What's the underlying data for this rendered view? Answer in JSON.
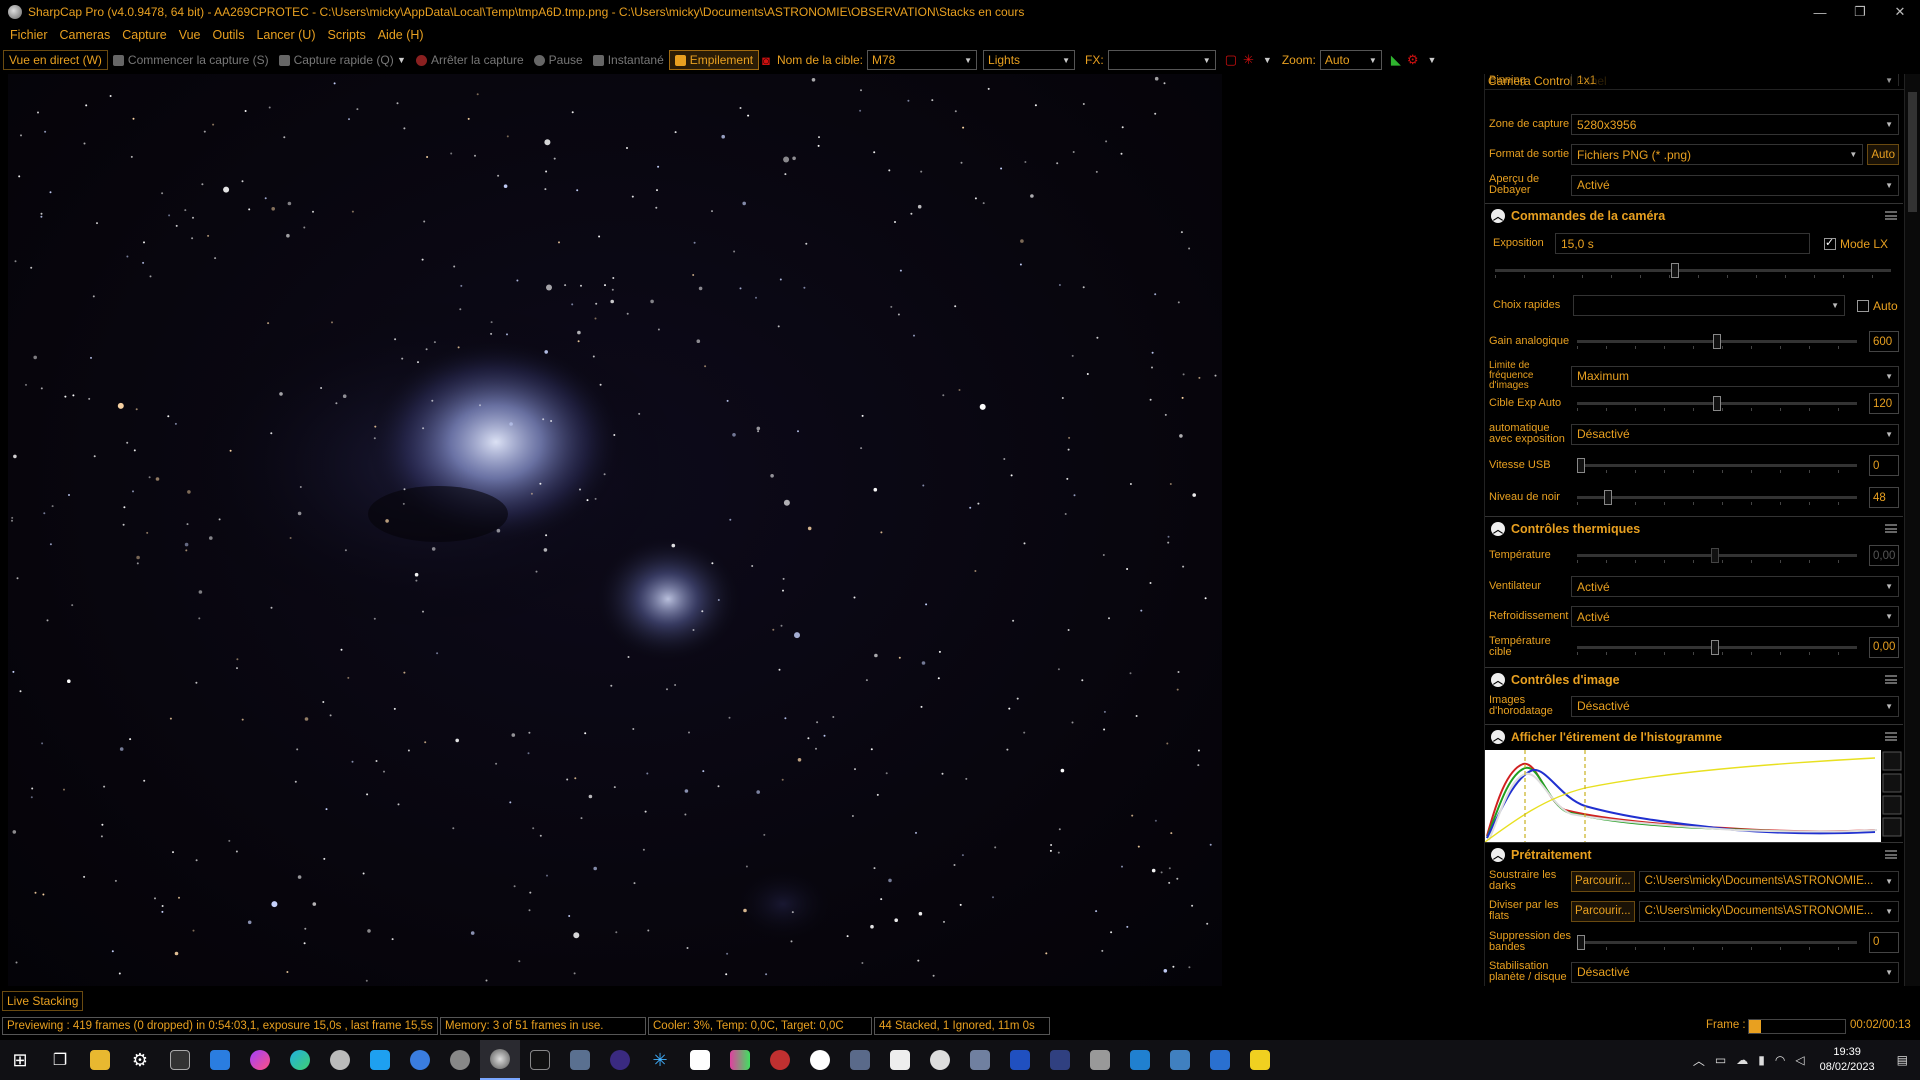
{
  "window": {
    "title": "SharpCap Pro (v4.0.9478, 64 bit) - AA269CPROTEC - C:\\Users\\micky\\AppData\\Local\\Temp\\tmpA6D.tmp.png - C:\\Users\\micky\\Documents\\ASTRONOMIE\\OBSERVATION\\Stacks en cours",
    "controls": [
      "—",
      "❐",
      "✕"
    ]
  },
  "menu": [
    "Fichier",
    "Cameras",
    "Capture",
    "Vue",
    "Outils",
    "Lancer (U)",
    "Scripts",
    "Aide (H)"
  ],
  "toolbar": {
    "live_view": "Vue en direct (W)",
    "start_capture": "Commencer la capture (S)",
    "quick_capture": "Capture rapide (Q)",
    "stop_capture": "Arrêter la capture",
    "pause": "Pause",
    "snapshot": "Instantané",
    "stacking": "Empilement",
    "target_label": "Nom de la cible:",
    "target_value": "M78",
    "frame_type": "Lights",
    "fx_label": "FX:",
    "fx_value": "",
    "zoom_label": "Zoom:",
    "zoom_value": "Auto"
  },
  "panel": {
    "title": "Camera Control Panel",
    "binning_label": "Binning",
    "binning_value": "1x1",
    "capture_area_label": "Zone de capture",
    "capture_area_value": "5280x3956",
    "output_format_label": "Format de sortie",
    "output_format_value": "Fichiers PNG (* .png)",
    "output_format_auto": "Auto",
    "debayer_label": "Aperçu de Debayer",
    "debayer_value": "Activé",
    "camera_section": "Commandes de la caméra",
    "exposure_label": "Exposition",
    "exposure_value": "15,0 s",
    "lx_mode": "Mode LX",
    "quick_choice_label": "Choix rapides",
    "quick_choice_auto": "Auto",
    "gain_label": "Gain analogique",
    "gain_value": "600",
    "gain_level": 0.5,
    "framerate_label": "Limite de fréquence d'images",
    "framerate_value": "Maximum",
    "auto_exp_target_label": "Cible Exp Auto",
    "auto_exp_target_value": "120",
    "auto_exp_target_level": 0.5,
    "auto_exposure_label": "automatique avec exposition",
    "auto_exposure_value": "Désactivé",
    "usb_label": "Vitesse USB",
    "usb_value": "0",
    "usb_level": 0.0,
    "black_label": "Niveau de noir",
    "black_value": "48",
    "black_level": 0.1,
    "thermal_section": "Contrôles thermiques",
    "temp_label": "Température",
    "temp_value": "0,00",
    "fan_label": "Ventilateur",
    "fan_value": "Activé",
    "cooling_label": "Refroidissement",
    "cooling_value": "Activé",
    "target_temp_label": "Température cible",
    "target_temp_value": "0,00",
    "image_section": "Contrôles d'image",
    "timestamp_label": "Images d'horodatage",
    "timestamp_value": "Désactivé",
    "histogram_section": "Afficher l'étirement de l'histogramme",
    "preprocess_section": "Prétraitement",
    "darks_label": "Soustraire les darks",
    "darks_path": "C:\\Users\\micky\\Documents\\ASTRONOMIE...",
    "flats_label": "Diviser par les flats",
    "flats_path": "C:\\Users\\micky\\Documents\\ASTRONOMIE...",
    "browse": "Parcourir...",
    "banding_label": "Suppression des bandes",
    "banding_value": "0",
    "banding_level": 0.0,
    "stabilization_label": "Stabilisation planète / disque",
    "stabilization_value": "Désactivé"
  },
  "status": {
    "live_stacking": "Live Stacking",
    "previewing": "Previewing : 419 frames (0 dropped) in 0:54:03,1, exposure 15,0s , last frame 15,5s",
    "memory": "Memory: 3 of 51 frames in use.",
    "cooler": "Cooler: 3%, Temp: 0,0C, Target: 0,0C",
    "stack": "44 Stacked, 1 Ignored, 11m 0s",
    "frame_label": "Frame :",
    "frame_progress": 0.13,
    "frame_time": "00:02/00:13"
  },
  "taskbar": {
    "time": "19:39",
    "date": "08/02/2023"
  },
  "colors": {
    "accent": "#e8a020",
    "background": "#000000",
    "nebula": "#aab4e8"
  }
}
